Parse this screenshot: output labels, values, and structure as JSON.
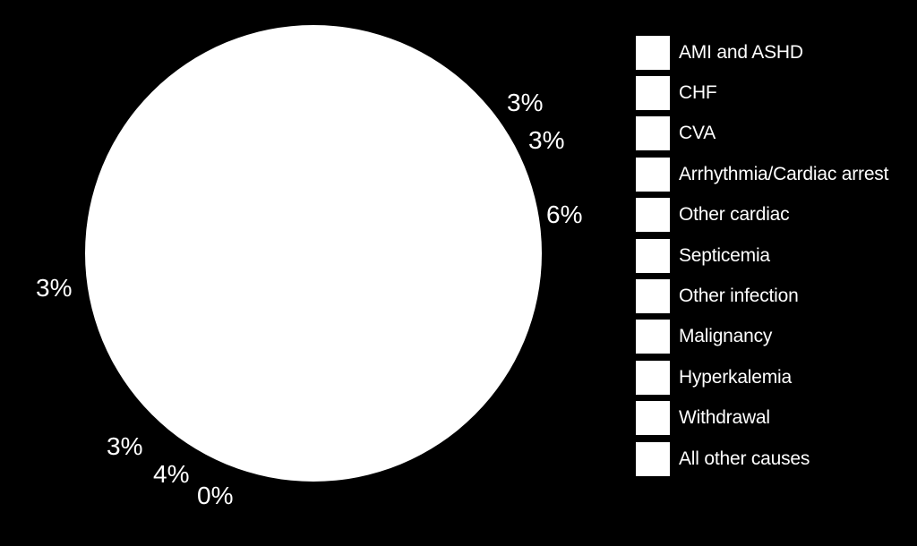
{
  "chart_data": {
    "type": "pie",
    "title": "",
    "categories": [
      "AMI and ASHD",
      "CHF",
      "CVA",
      "Arrhythmia/Cardiac arrest",
      "Other cardiac",
      "Septicemia",
      "Other infection",
      "Malignancy",
      "Hyperkalemia",
      "Withdrawal",
      "All other causes"
    ],
    "visible_data_labels": [
      "3%",
      "3%",
      "6%",
      "3%",
      "3%",
      "4%",
      "0%"
    ],
    "slice_fill": "#ffffff",
    "background": "#000000",
    "legend": {
      "placement": "right",
      "entries": [
        "AMI and ASHD",
        "CHF",
        "CVA",
        "Arrhythmia/Cardiac arrest",
        "Other cardiac",
        "Septicemia",
        "Other infection",
        "Malignancy",
        "Hyperkalemia",
        "Withdrawal",
        "All other causes"
      ]
    }
  },
  "labels": [
    {
      "text": "3%",
      "pos": "upper-right-1"
    },
    {
      "text": "3%",
      "pos": "upper-right-2"
    },
    {
      "text": "6%",
      "pos": "right"
    },
    {
      "text": "3%",
      "pos": "left"
    },
    {
      "text": "3%",
      "pos": "lower-left-1"
    },
    {
      "text": "4%",
      "pos": "lower-left-2"
    },
    {
      "text": "0%",
      "pos": "lower-left-3"
    }
  ]
}
